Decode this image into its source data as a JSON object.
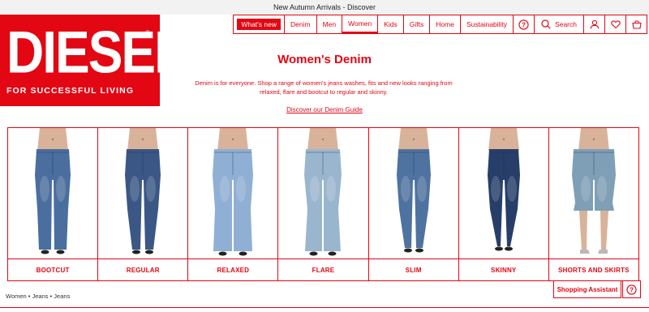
{
  "announcement": "New Autumn Arrivals - Discover",
  "brand": {
    "wordmark": "DIESEL",
    "reg_mark": "®",
    "tagline": "FOR SUCCESSFUL LIVING",
    "color": "#e30613"
  },
  "nav": {
    "whats_new": "What's new",
    "items": [
      "Denim",
      "Men",
      "Women",
      "Kids",
      "Gifts",
      "Home",
      "Sustainability"
    ],
    "active_item": "Women",
    "search_label": "Search",
    "icons": [
      "help-icon",
      "search-icon",
      "account-icon",
      "wishlist-icon",
      "cart-icon"
    ]
  },
  "page": {
    "title": "Women's Denim",
    "description": "Denim is for everyone. Shop a range of women's jeans washes, fits and new looks ranging from relaxed, flare and bootcut to regular and skinny.",
    "guide_link": "Discover our Denim Guide"
  },
  "categories": [
    {
      "label": "BOOTCUT",
      "wash": "#4a6e9e"
    },
    {
      "label": "REGULAR",
      "wash": "#3a5785"
    },
    {
      "label": "RELAXED",
      "wash": "#8fb0d4"
    },
    {
      "label": "FLARE",
      "wash": "#9ab6cf"
    },
    {
      "label": "SLIM",
      "wash": "#4f73a0"
    },
    {
      "label": "SKINNY",
      "wash": "#273e69"
    },
    {
      "label": "SHORTS AND SKIRTS",
      "wash": "#7f9fb6"
    }
  ],
  "breadcrumb": "Women • Jeans • Jeans",
  "assistant_label": "Shopping Assistant"
}
